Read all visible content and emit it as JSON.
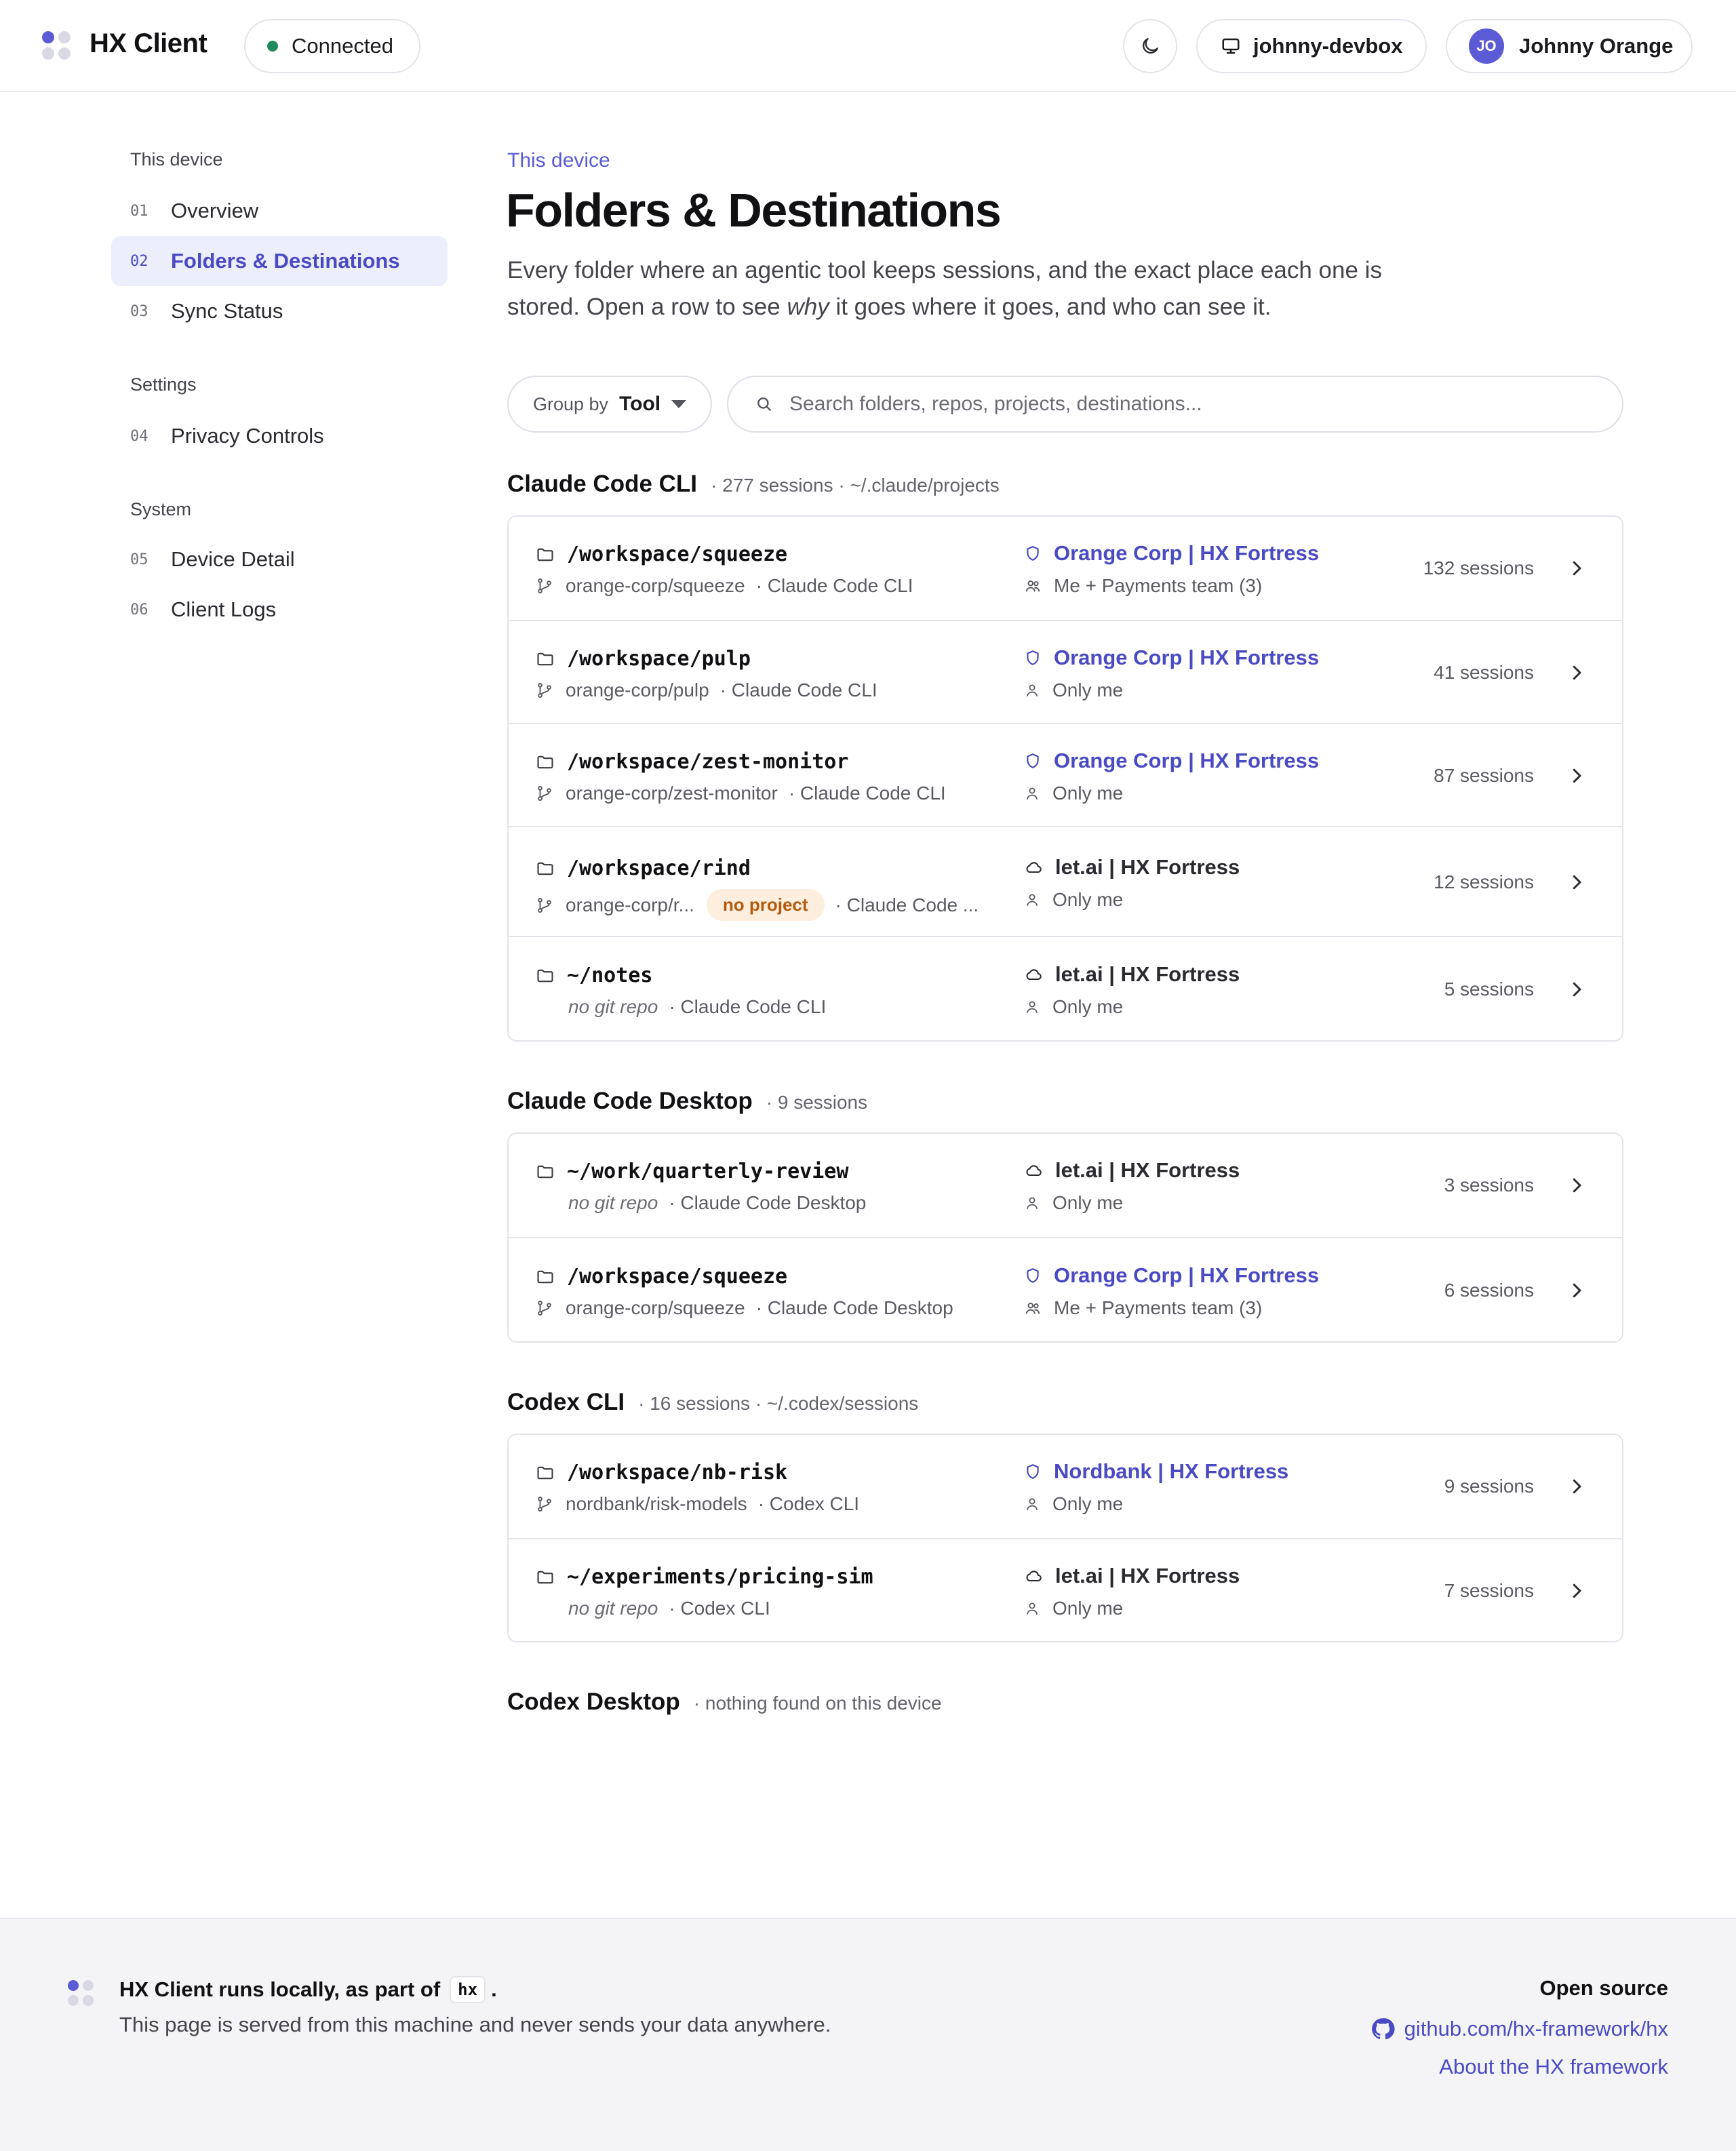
{
  "header": {
    "app_title": "HX Client",
    "status": "Connected",
    "status_color": "#1f8a5b",
    "theme_icon": "moon-icon",
    "device": "johnny-devbox",
    "user_initials": "JO",
    "user_name": "Johnny Orange",
    "accent": "#5b5bd6"
  },
  "sidebar": {
    "sections": [
      {
        "title": "This device",
        "items": [
          {
            "num": "01",
            "label": "Overview"
          },
          {
            "num": "02",
            "label": "Folders & Destinations",
            "active": true
          },
          {
            "num": "03",
            "label": "Sync Status"
          }
        ]
      },
      {
        "title": "Settings",
        "items": [
          {
            "num": "04",
            "label": "Privacy Controls"
          }
        ]
      },
      {
        "title": "System",
        "items": [
          {
            "num": "05",
            "label": "Device Detail"
          },
          {
            "num": "06",
            "label": "Client Logs"
          }
        ]
      }
    ]
  },
  "main": {
    "eyebrow": "This device",
    "title": "Folders & Destinations",
    "desc_before": "Every folder where an agentic tool keeps sessions, and the exact place each one is stored. Open a row to see ",
    "desc_em": "why",
    "desc_after": " it goes where it goes, and who can see it.",
    "group_by_label": "Group by",
    "group_by_value": "Tool",
    "search_placeholder": "Search folders, repos, projects, destinations..."
  },
  "groups": [
    {
      "name": "Claude Code CLI",
      "meta": "· 277 sessions · ~/.claude/projects",
      "rows": [
        {
          "path": "/workspace/squeeze",
          "repo": "orange-corp/squeeze",
          "tool": "· Claude Code CLI",
          "dest": "Orange Corp | HX Fortress",
          "dest_type": "org",
          "vis": "Me + Payments team (3)",
          "vis_type": "team",
          "count": "132 sessions"
        },
        {
          "path": "/workspace/pulp",
          "repo": "orange-corp/pulp",
          "tool": "· Claude Code CLI",
          "dest": "Orange Corp | HX Fortress",
          "dest_type": "org",
          "vis": "Only me",
          "vis_type": "me",
          "count": "41 sessions"
        },
        {
          "path": "/workspace/zest-monitor",
          "repo": "orange-corp/zest-monitor",
          "tool": "· Claude Code CLI",
          "dest": "Orange Corp | HX Fortress",
          "dest_type": "org",
          "vis": "Only me",
          "vis_type": "me",
          "count": "87 sessions"
        },
        {
          "path": "/workspace/rind",
          "repo": "orange-corp/r...",
          "badge": "no project",
          "tool": "· Claude Code ...",
          "dest": "let.ai | HX Fortress",
          "dest_type": "cloud",
          "vis": "Only me",
          "vis_type": "me",
          "count": "12 sessions"
        },
        {
          "path": "~/notes",
          "repo": "no git repo",
          "no_repo": true,
          "tool": "· Claude Code CLI",
          "dest": "let.ai | HX Fortress",
          "dest_type": "cloud",
          "vis": "Only me",
          "vis_type": "me",
          "count": "5 sessions"
        }
      ]
    },
    {
      "name": "Claude Code Desktop",
      "meta": "· 9 sessions",
      "rows": [
        {
          "path": "~/work/quarterly-review",
          "repo": "no git repo",
          "no_repo": true,
          "tool": "· Claude Code Desktop",
          "dest": "let.ai | HX Fortress",
          "dest_type": "cloud",
          "vis": "Only me",
          "vis_type": "me",
          "count": "3 sessions"
        },
        {
          "path": "/workspace/squeeze",
          "repo": "orange-corp/squeeze",
          "tool": "· Claude Code Desktop",
          "dest": "Orange Corp | HX Fortress",
          "dest_type": "org",
          "vis": "Me + Payments team (3)",
          "vis_type": "team",
          "count": "6 sessions"
        }
      ]
    },
    {
      "name": "Codex CLI",
      "meta": "· 16 sessions · ~/.codex/sessions",
      "rows": [
        {
          "path": "/workspace/nb-risk",
          "repo": "nordbank/risk-models",
          "tool": "· Codex CLI",
          "dest": "Nordbank | HX Fortress",
          "dest_type": "org",
          "vis": "Only me",
          "vis_type": "me",
          "count": "9 sessions"
        },
        {
          "path": "~/experiments/pricing-sim",
          "repo": "no git repo",
          "no_repo": true,
          "tool": "· Codex CLI",
          "dest": "let.ai | HX Fortress",
          "dest_type": "cloud",
          "vis": "Only me",
          "vis_type": "me",
          "count": "7 sessions"
        }
      ]
    },
    {
      "name": "Codex Desktop",
      "meta": "· nothing found on this device",
      "rows": []
    }
  ],
  "footer": {
    "title_before": "HX Client runs locally, as part of",
    "title_code": "hx",
    "title_after": ".",
    "desc": "This page is served from this machine and never sends your data anywhere.",
    "open_source": "Open source",
    "github": "github.com/hx-framework/hx",
    "about": "About the HX framework"
  }
}
